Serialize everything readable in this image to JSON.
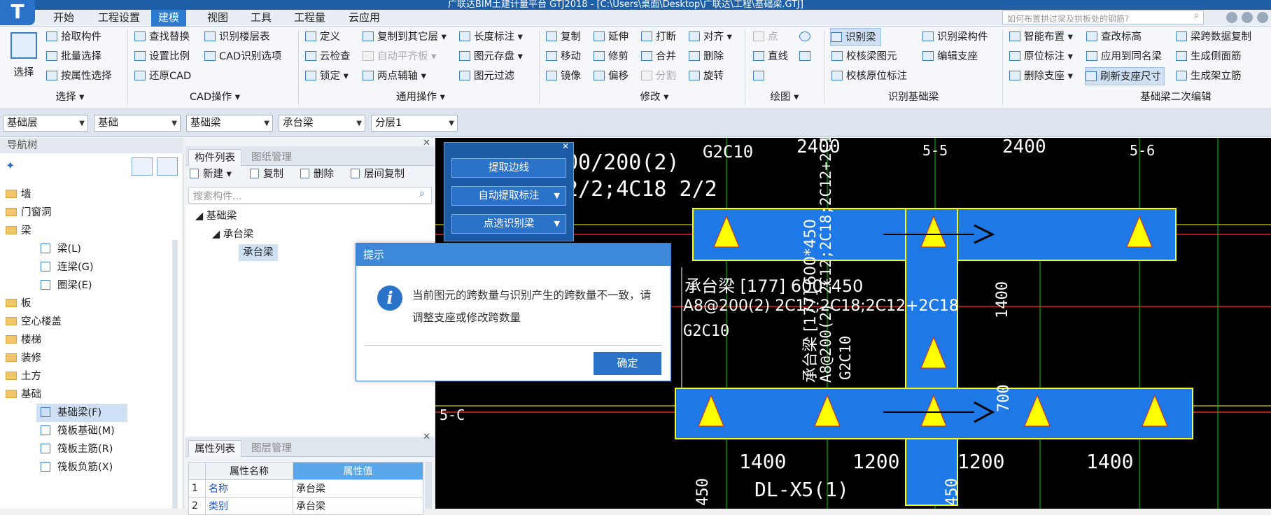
{
  "title_bar": {
    "text": "广联达BIM土建计量平台 GTJ2018 - [C:\\Users\\桌面\\Desktop\\广联达\\工程\\基础梁.GTJ]"
  },
  "menu": {
    "tabs": [
      "开始",
      "工程设置",
      "建模",
      "视图",
      "工具",
      "工程量",
      "云应用"
    ],
    "active_index": 2
  },
  "search": {
    "placeholder": "如何布置拱过梁及拱板处的钢筋?"
  },
  "ribbon": {
    "select_big": "选择",
    "select_group": {
      "items": [
        "拾取构件",
        "批量选择",
        "按属性选择"
      ],
      "label": "选择"
    },
    "cad_group": {
      "items": [
        "查找替换",
        "识别楼层表",
        "设置比例",
        "CAD识别选项",
        "还原CAD"
      ],
      "label": "CAD操作"
    },
    "general_group": {
      "items": [
        "定义",
        "复制到其它层",
        "长度标注",
        "云检查",
        "自动平齐板",
        "图元存盘",
        "锁定",
        "两点辅轴",
        "图元过滤"
      ],
      "label": "通用操作"
    },
    "modify_group": {
      "items": [
        "复制",
        "延伸",
        "打断",
        "对齐",
        "移动",
        "修剪",
        "合并",
        "删除",
        "镜像",
        "偏移",
        "分割",
        "旋转"
      ],
      "label": "修改"
    },
    "draw_group": {
      "items": [
        "点",
        "直线"
      ],
      "label": "绘图"
    },
    "identify_group": {
      "items": [
        "识别梁",
        "识别梁构件",
        "校核梁图元",
        "编辑支座",
        "校核原位标注"
      ],
      "label": "识别基础梁"
    },
    "edit2_group": {
      "items": [
        "智能布置",
        "查改标高",
        "梁跨数据复制",
        "原位标注",
        "应用到同名梁",
        "生成侧面筋",
        "删除支座",
        "刷新支座尺寸",
        "生成架立筋"
      ],
      "label": "基础梁二次编辑"
    }
  },
  "dropdowns": [
    "基础层",
    "基础",
    "基础梁",
    "承台梁",
    "分层1"
  ],
  "nav": {
    "title": "导航树",
    "items": [
      "墙",
      "门窗洞",
      "梁",
      "梁(L)",
      "连梁(G)",
      "圈梁(E)",
      "板",
      "空心楼盖",
      "楼梯",
      "装修",
      "土方",
      "基础",
      "基础梁(F)",
      "筏板基础(M)",
      "筏板主筋(R)",
      "筏板负筋(X)"
    ]
  },
  "component_panel": {
    "tabs": [
      "构件列表",
      "图纸管理"
    ],
    "tools": [
      "新建",
      "复制",
      "删除",
      "层间复制"
    ],
    "search_placeholder": "搜索构件...",
    "tree": [
      "基础梁",
      "承台梁",
      "承台梁"
    ]
  },
  "property_panel": {
    "tabs": [
      "属性列表",
      "图层管理"
    ],
    "headers": [
      "属性名称",
      "属性值"
    ],
    "rows": [
      [
        "1",
        "名称",
        "承台梁"
      ],
      [
        "2",
        "类别",
        "承台梁"
      ]
    ]
  },
  "float_panel": {
    "buttons": [
      "提取边线",
      "自动提取标注",
      "点选识别梁"
    ]
  },
  "dialog": {
    "title": "提示",
    "message": "当前图元的跨数量与识别产生的跨数量不一致，请调整支座或修改跨数量",
    "ok": "确定"
  },
  "cad": {
    "texts": [
      "G2C10",
      "2400",
      "5-5",
      "2400",
      "5-6",
      "00/200(2)",
      "2/2;4C18 2/2",
      "承台梁 [177] 600*450",
      "A8@200(2) 2C12;2C18;2C12+2C18",
      "G2C10",
      "1400",
      "700",
      "5-C",
      "1400",
      "1200",
      "1200",
      "1400",
      "DL-X5(1)",
      "450",
      "450",
      "承台梁 [177] 600*450",
      "A8@200(2) 2C12;2C18;2C12+2C18",
      "G2C10"
    ],
    "colors": {
      "beam": "#1e78e6",
      "grid": "#00d000",
      "axis": "#e02020",
      "yellow": "#ffff00",
      "white": "#ffffff"
    }
  }
}
